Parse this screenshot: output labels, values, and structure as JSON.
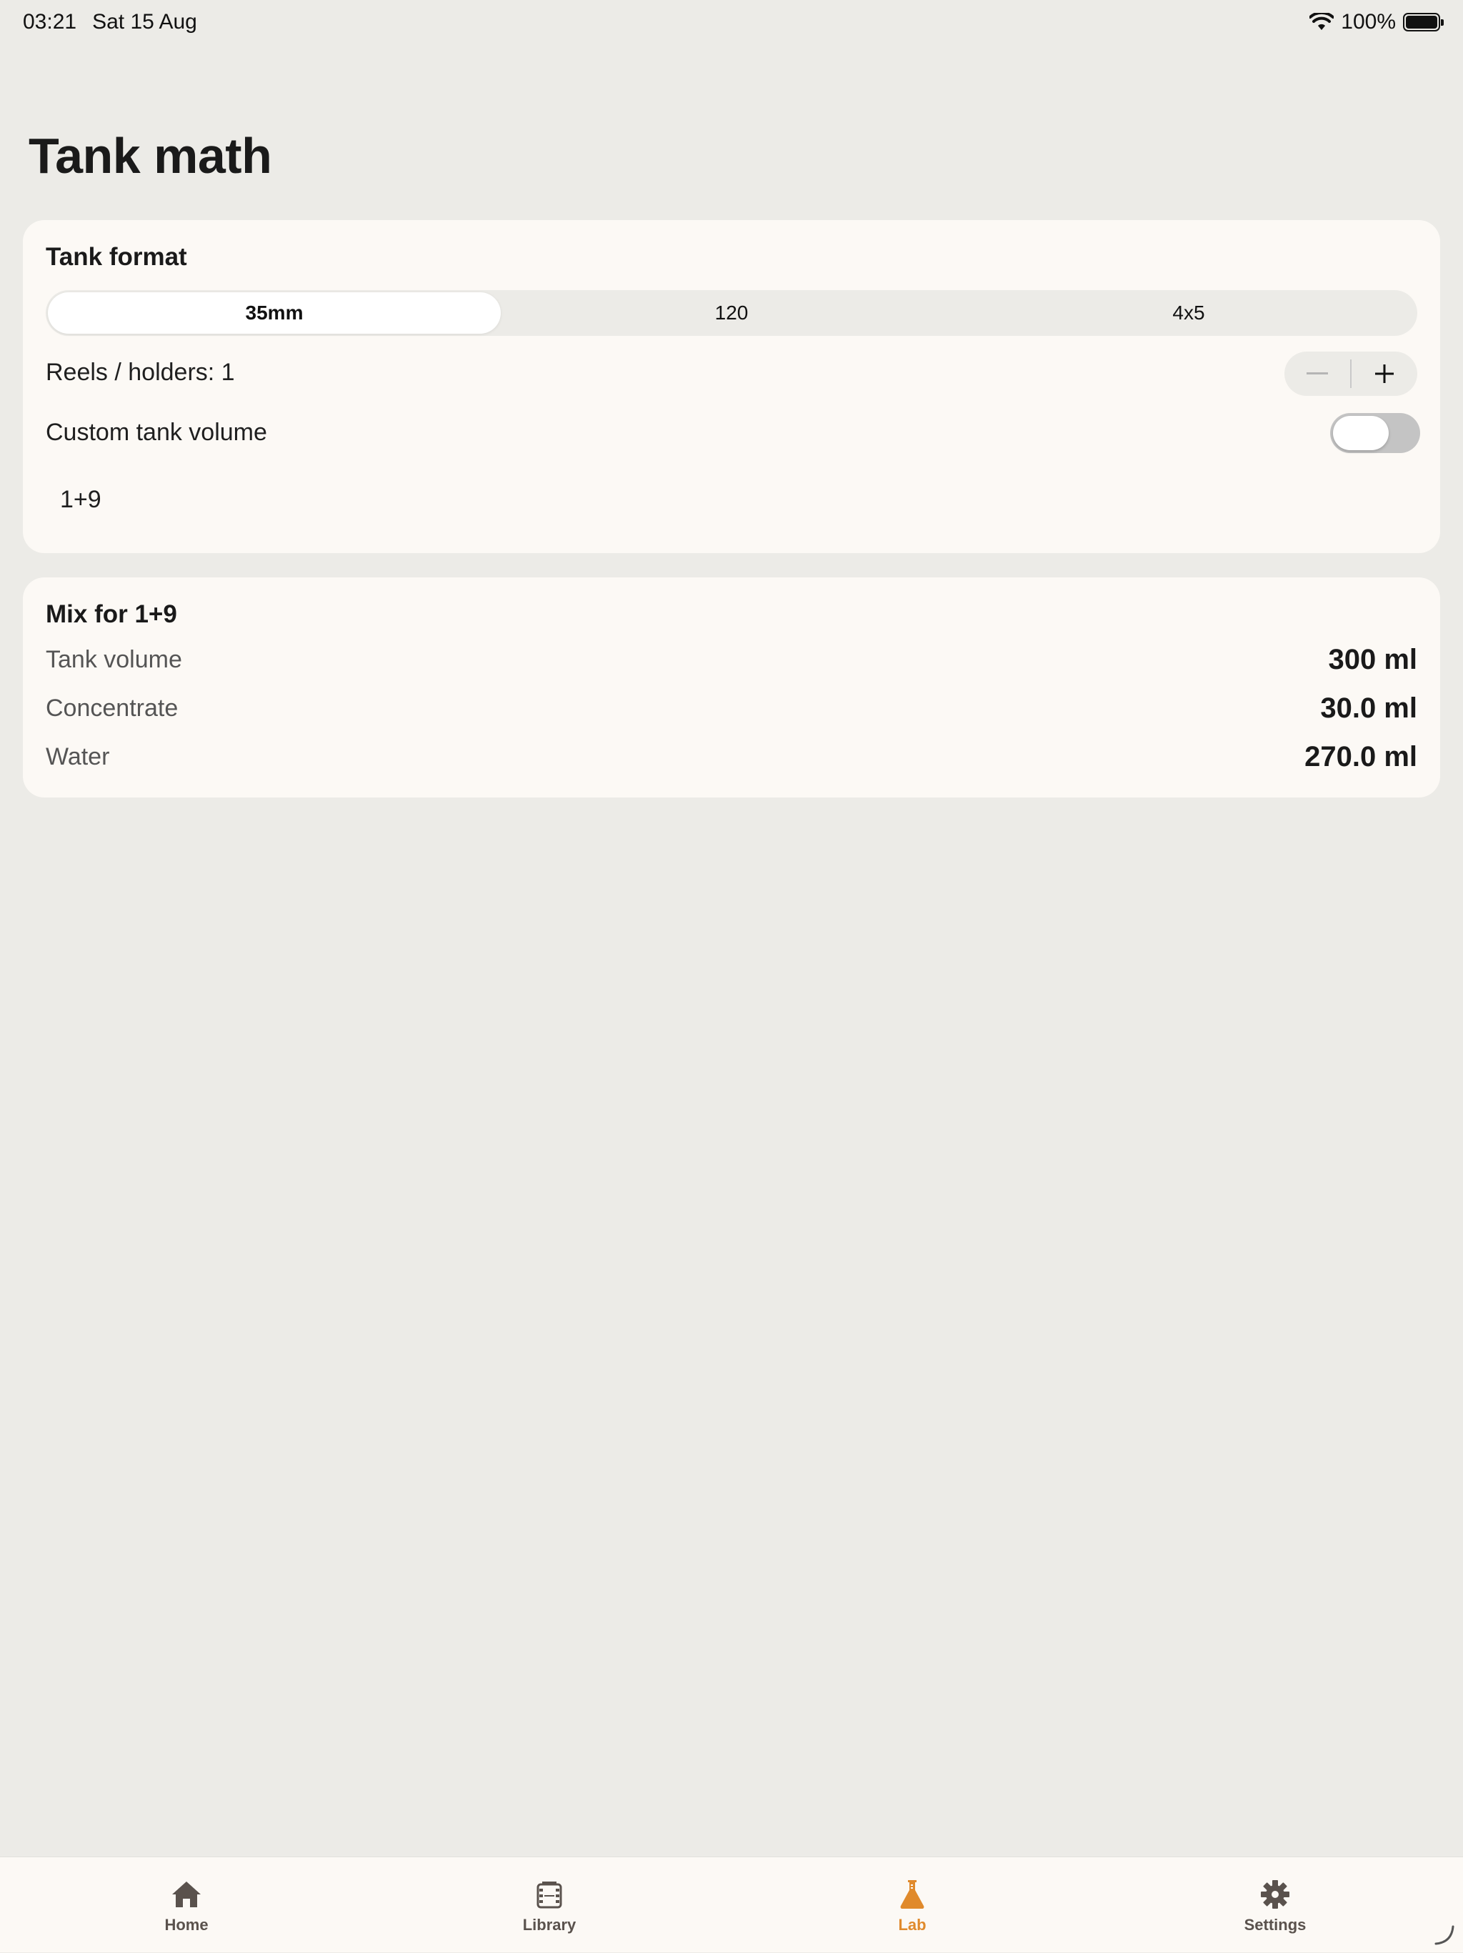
{
  "status": {
    "time": "03:21",
    "date": "Sat 15 Aug",
    "battery": "100%"
  },
  "page": {
    "title": "Tank math"
  },
  "tank_format": {
    "title": "Tank format",
    "segments": [
      "35mm",
      "120",
      "4x5"
    ],
    "selected_segment": "35mm",
    "reels_label": "Reels / holders: 1",
    "custom_volume_label": "Custom tank volume",
    "custom_volume_on": false,
    "ratio": "1+9"
  },
  "mix": {
    "title": "Mix for 1+9",
    "rows": [
      {
        "label": "Tank volume",
        "value": "300 ml"
      },
      {
        "label": "Concentrate",
        "value": "30.0 ml"
      },
      {
        "label": "Water",
        "value": "270.0 ml"
      }
    ]
  },
  "tabs": [
    {
      "label": "Home",
      "icon": "house-icon"
    },
    {
      "label": "Library",
      "icon": "film-icon"
    },
    {
      "label": "Lab",
      "icon": "flask-icon",
      "active": true
    },
    {
      "label": "Settings",
      "icon": "gear-icon"
    }
  ],
  "colors": {
    "accent": "#E08A2C",
    "background": "#ECEBE7",
    "card": "#FCF9F5"
  }
}
